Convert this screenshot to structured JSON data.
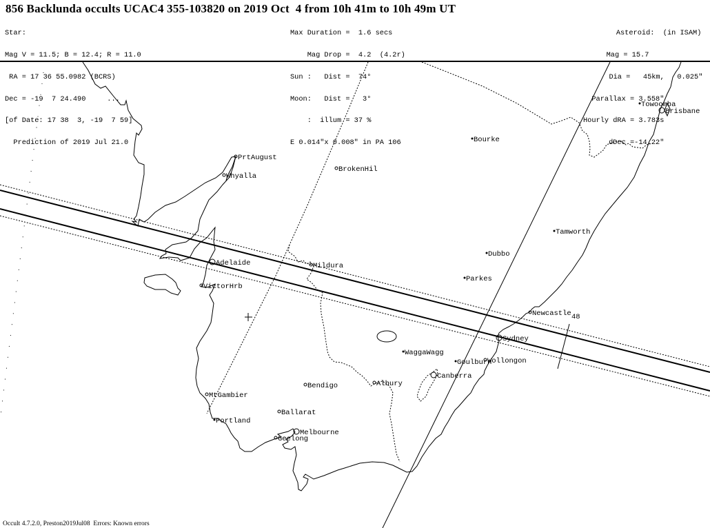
{
  "title": "856 Backlunda occults UCAC4 355-103820 on 2019 Oct  4 from 10h 41m to 10h 49m UT",
  "star": {
    "heading": "Star:",
    "mag_line": "Mag V = 11.5; B = 12.4; R = 11.0",
    "ra_line": " RA = 17 36 55.0982 (BCRS)",
    "dec_line": "Dec = -19  7 24.490     ...",
    "of_date_line": "[of Date: 17 38  3, -19  7 59]",
    "prediction_line": "  Prediction of 2019 Jul 21.0"
  },
  "event": {
    "max_duration_line": "Max Duration =  1.6 secs",
    "mag_drop_line": "    Mag Drop =  4.2  (4.2r)",
    "sun_line": "Sun :   Dist =  74°",
    "moon_dist_line": "Moon:   Dist =   3°",
    "moon_illum_line": "    :  illum = 37 %",
    "error_ellipse_line": "E 0.014\"x 0.008\" in PA 106"
  },
  "asteroid": {
    "heading": "Asteroid:  (in ISAM)",
    "mag_line": "Mag = 15.7",
    "dia_line": "Dia =   45km,   0.025\"",
    "parallax_line": "Parallax = 3.558\"",
    "hourly_dra_line": "Hourly dRA = 3.783s",
    "ddec_line": "dDec =-14.22\""
  },
  "map": {
    "time_tick_label": "48",
    "cities": [
      {
        "name": "PrtAugust",
        "marker": "small-circle"
      },
      {
        "name": "Whyalla",
        "marker": "small-circle"
      },
      {
        "name": "BrokenHil",
        "marker": "small-circle"
      },
      {
        "name": "Bourke",
        "marker": "dot"
      },
      {
        "name": "Towoomba",
        "marker": "dot"
      },
      {
        "name": "Brisbane",
        "marker": "large-circle"
      },
      {
        "name": "Tamworth",
        "marker": "dot"
      },
      {
        "name": "Dubbo",
        "marker": "dot"
      },
      {
        "name": "Parkes",
        "marker": "dot"
      },
      {
        "name": "Mildura",
        "marker": "small-circle"
      },
      {
        "name": "Adelaide",
        "marker": "large-circle"
      },
      {
        "name": "VictorHrb",
        "marker": "small-circle"
      },
      {
        "name": "Newcastle",
        "marker": "small-circle"
      },
      {
        "name": "Sydney",
        "marker": "large-circle"
      },
      {
        "name": "WaggaWagg",
        "marker": "dot"
      },
      {
        "name": "Goulburn",
        "marker": "dot"
      },
      {
        "name": "Wollongon",
        "marker": "small-circle"
      },
      {
        "name": "Canberra",
        "marker": "large-circle"
      },
      {
        "name": "Albury",
        "marker": "small-circle"
      },
      {
        "name": "Bendigo",
        "marker": "small-circle"
      },
      {
        "name": "MtGambier",
        "marker": "small-circle"
      },
      {
        "name": "Ballarat",
        "marker": "small-circle"
      },
      {
        "name": "Portland",
        "marker": "dot"
      },
      {
        "name": "Melbourne",
        "marker": "large-circle"
      },
      {
        "name": "Geelong",
        "marker": "small-circle"
      }
    ]
  },
  "footer": "Occult 4.7.2.0, Preston2019Jul08  Errors: Known errors"
}
